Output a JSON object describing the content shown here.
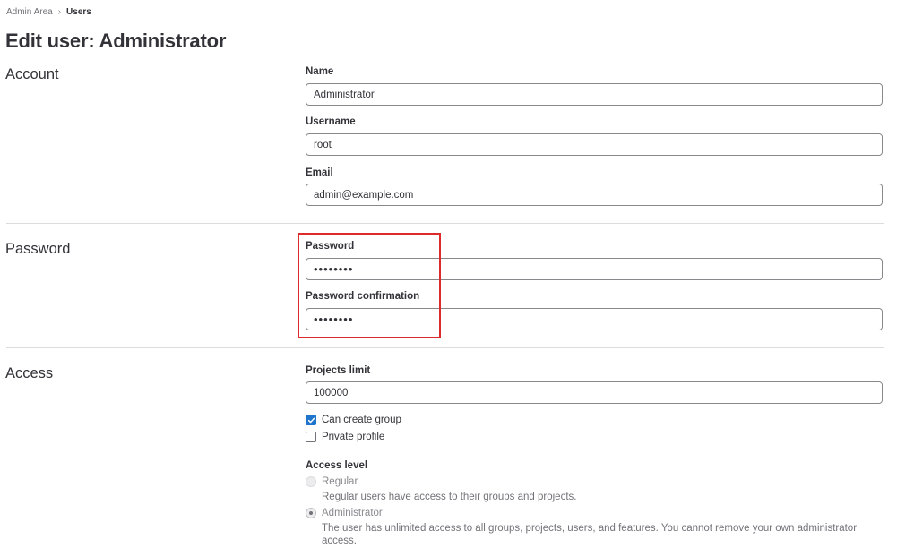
{
  "breadcrumb": {
    "parent": "Admin Area",
    "separator": "›",
    "current": "Users"
  },
  "page_title": "Edit user: Administrator",
  "sections": {
    "account": {
      "title": "Account",
      "name_label": "Name",
      "name_value": "Administrator",
      "username_label": "Username",
      "username_value": "root",
      "email_label": "Email",
      "email_value": "admin@example.com"
    },
    "password": {
      "title": "Password",
      "password_label": "Password",
      "password_value": "••••••••",
      "confirm_label": "Password confirmation",
      "confirm_value": "••••••••"
    },
    "access": {
      "title": "Access",
      "projects_limit_label": "Projects limit",
      "projects_limit_value": "100000",
      "can_create_group": {
        "label": "Can create group",
        "checked": true
      },
      "private_profile": {
        "label": "Private profile",
        "checked": false
      },
      "access_level_label": "Access level",
      "levels": [
        {
          "label": "Regular",
          "help": "Regular users have access to their groups and projects.",
          "selected": false
        },
        {
          "label": "Administrator",
          "help": "The user has unlimited access to all groups, projects, users, and features. You cannot remove your own administrator access.",
          "selected": true
        }
      ]
    }
  },
  "colors": {
    "highlight": "#dd2b2b",
    "checkbox_checked": "#1f75cb",
    "text": "#333238",
    "muted": "#737278"
  }
}
